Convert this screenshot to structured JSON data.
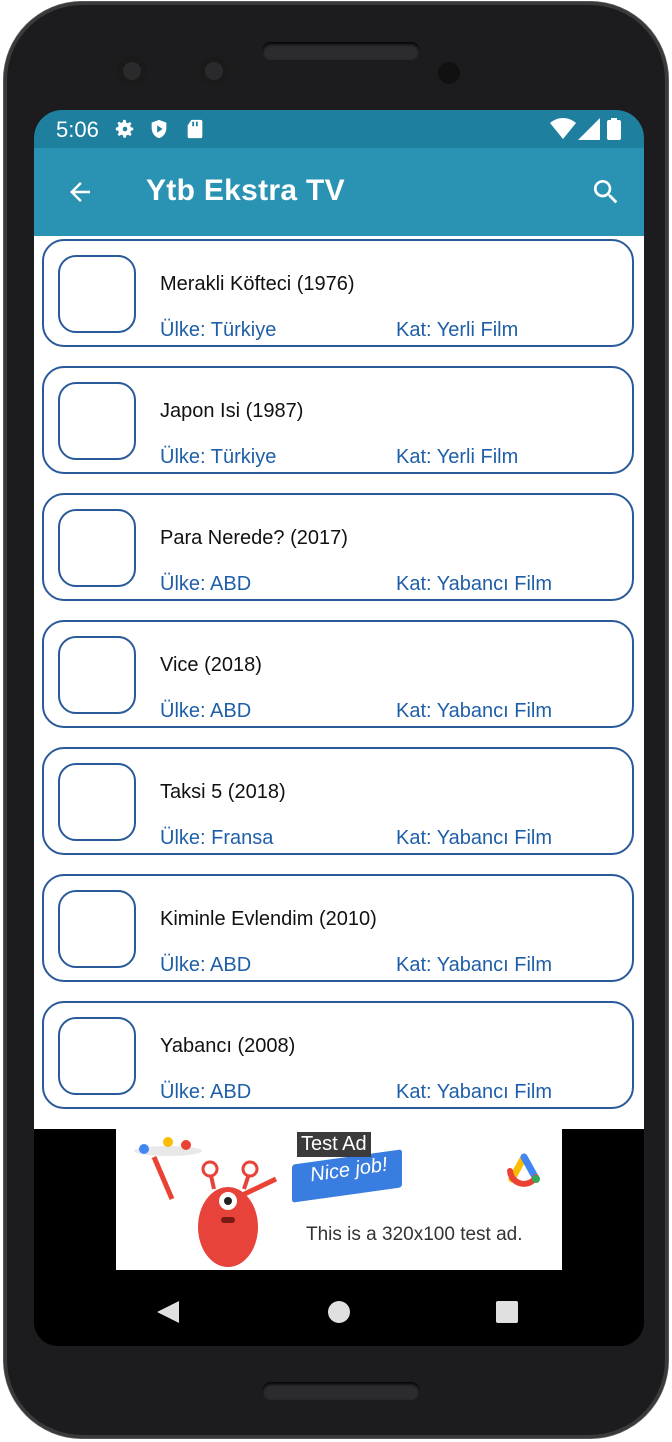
{
  "status_bar": {
    "time": "5:06",
    "icons": [
      "gear-icon",
      "play-protect-icon",
      "sd-card-icon",
      "wifi-icon",
      "signal-icon",
      "battery-icon"
    ]
  },
  "app_bar": {
    "title": "Ytb Ekstra TV",
    "back_icon": "arrow-left-icon",
    "search_icon": "search-icon",
    "color": "#2a93b4"
  },
  "movies": [
    {
      "title": "Merakli Köfteci (1976)",
      "country": "Ülke: Türkiye",
      "category": "Kat: Yerli Film"
    },
    {
      "title": "Japon Isi (1987)",
      "country": "Ülke: Türkiye",
      "category": "Kat: Yerli Film"
    },
    {
      "title": "Para Nerede? (2017)",
      "country": "Ülke: ABD",
      "category": "Kat: Yabancı Film"
    },
    {
      "title": "Vice (2018)",
      "country": "Ülke: ABD",
      "category": "Kat: Yabancı Film"
    },
    {
      "title": "Taksi 5 (2018)",
      "country": "Ülke: Fransa",
      "category": "Kat: Yabancı Film"
    },
    {
      "title": "Kiminle Evlendim (2010)",
      "country": "Ülke: ABD",
      "category": "Kat: Yabancı Film"
    },
    {
      "title": "Yabancı (2008)",
      "country": "Ülke: ABD",
      "category": "Kat: Yabancı Film"
    }
  ],
  "ad": {
    "label": "Test Ad",
    "banner": "Nice job!",
    "text": "This is a 320x100 test ad."
  },
  "nav": {
    "back": "nav-back-icon",
    "home": "nav-home-icon",
    "recents": "nav-recents-icon"
  }
}
